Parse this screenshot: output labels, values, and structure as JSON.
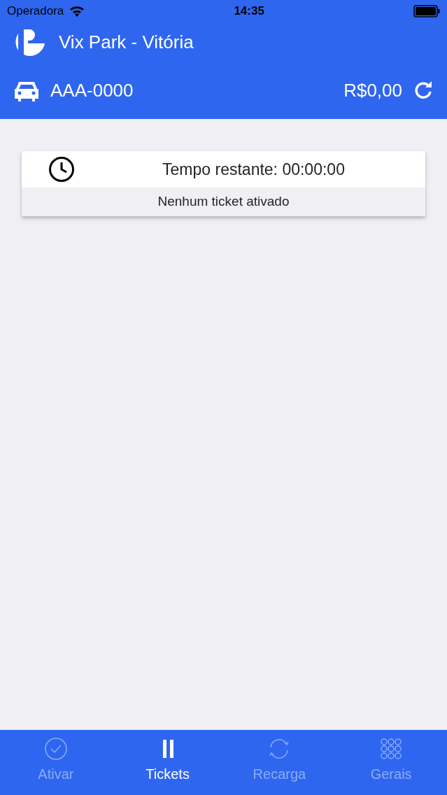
{
  "status_bar": {
    "carrier": "Operadora",
    "time": "14:35"
  },
  "header": {
    "title": "Vix Park - Vitória",
    "plate": "AAA-0000",
    "balance": "R$0,00"
  },
  "ticket_card": {
    "time_label": "Tempo restante: 00:00:00",
    "message": "Nenhum ticket ativado"
  },
  "tab_bar": [
    {
      "label": "Ativar",
      "kind": "check",
      "selected": false
    },
    {
      "label": "Tickets",
      "kind": "pause",
      "selected": true
    },
    {
      "label": "Recarga",
      "kind": "refresh",
      "selected": false
    },
    {
      "label": "Gerais",
      "kind": "grid",
      "selected": false
    }
  ]
}
